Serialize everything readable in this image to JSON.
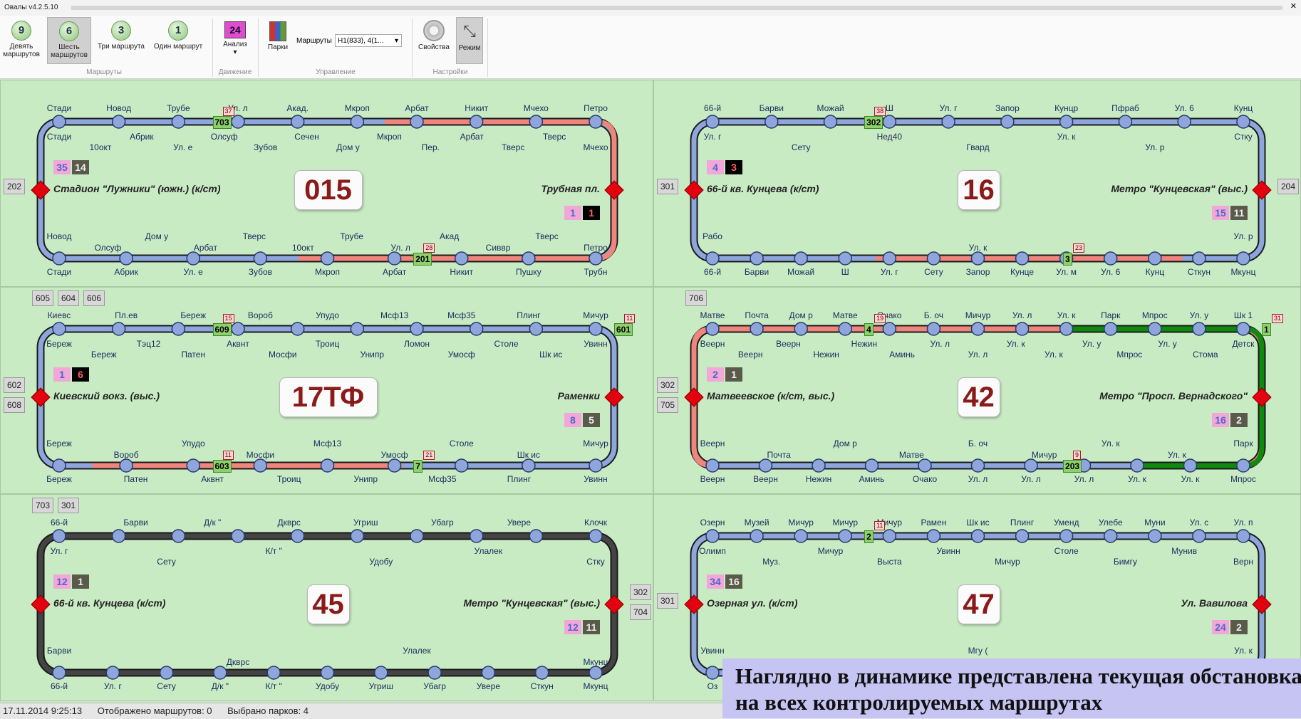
{
  "window": {
    "title": "Овалы v4.2.5.10"
  },
  "ribbon": {
    "buttons": [
      {
        "num": "9",
        "label": "Девять маршрутов"
      },
      {
        "num": "6",
        "label": "Шесть маршрутов"
      },
      {
        "num": "3",
        "label": "Три маршрута"
      },
      {
        "num": "1",
        "label": "Один маршрут"
      }
    ],
    "groups": {
      "routes": "Маршруты",
      "movement": "Движение",
      "control": "Управление",
      "settings": "Настройки"
    },
    "analysis": {
      "num": "24",
      "label": "Анализ"
    },
    "parks_label": "Парки",
    "routes_combo_label": "Маршруты",
    "routes_combo_value": "Н1(833), 4(1...",
    "props_label": "Свойства",
    "mode_label": "Режим"
  },
  "status": {
    "datetime": "17.11.2014 9:25:13",
    "shown": "Отображено маршрутов: 0",
    "parks": "Выбрано парков: 4"
  },
  "overlay": {
    "text": "Наглядно в динамике представлена текущая обстановка на всех контролируемых маршрутах"
  },
  "panels": [
    {
      "route": "015",
      "left_terminal": "Стадион \"Лужники\" (южн.) (к/ст)",
      "right_terminal": "Трубная пл.",
      "left_garages": [
        "202"
      ],
      "right_garages": [],
      "top_garages": [],
      "left_counts": [
        "35",
        "14"
      ],
      "right_counts": [
        "1",
        "1"
      ],
      "right_black": true,
      "left_black": false,
      "top_labels": [
        "Стади",
        "Новод",
        "Трубе",
        "Ул. л",
        "Акад.",
        "Мкроп",
        "Арбат",
        "Никит",
        "Мчехо",
        "Петро"
      ],
      "top_labels2": [
        "Стади",
        "10окт",
        "Абрик",
        "Ул. е",
        "Олсуф",
        "Зубов",
        "Сечен",
        "Дом у",
        "Мкроп",
        "Пер.",
        "Арбат",
        "Тверс",
        "Тверс",
        "Мчехо"
      ],
      "bottom_labels": [
        "Новод",
        "Олсуф",
        "Дом у",
        "Арбат",
        "Тверс",
        "10окт",
        "Трубе",
        "Ул. л",
        "Акад",
        "Сиввр",
        "Тверс",
        "Петро"
      ],
      "bottom_labels2": [
        "Стади",
        "Абрик",
        "Ул. е",
        "Зубов",
        "Мкроп",
        "Арбат",
        "Никит",
        "Пушку",
        "Трубн"
      ],
      "buses": [
        {
          "id": "703",
          "badge": "37"
        },
        {
          "id": "201",
          "badge": "28"
        }
      ]
    },
    {
      "route": "16",
      "left_terminal": "66-й кв. Кунцева (к/ст)",
      "right_terminal": "Метро \"Кунцевская\" (выс.)",
      "left_garages": [
        "301"
      ],
      "right_garages": [
        "204"
      ],
      "top_garages": [],
      "left_counts": [
        "4",
        "3"
      ],
      "right_counts": [
        "15",
        "11"
      ],
      "right_black": false,
      "left_black": true,
      "top_labels": [
        "66-й",
        "Барви",
        "Можай",
        "Ш",
        "Ул. г",
        "Запор",
        "Кунцр",
        "Пфраб",
        "Ул. 6",
        "Кунц"
      ],
      "top_labels2": [
        "Ул. г",
        "Сету",
        "Нед40",
        "Гвард",
        "Ул. к",
        "Ул. р",
        "Стку"
      ],
      "bottom_labels": [
        "Рабо",
        "Ул. к",
        "Ул. р"
      ],
      "bottom_labels2": [
        "66-й",
        "Барви",
        "Можай",
        "Ш",
        "Ул. г",
        "Сету",
        "Запор",
        "Кунце",
        "Ул. м",
        "Ул. 6",
        "Кунц",
        "Сткун",
        "Мкунц"
      ],
      "buses": [
        {
          "id": "302",
          "badge": "38"
        },
        {
          "id": "3",
          "badge": "23"
        }
      ]
    },
    {
      "route": "17ТФ",
      "left_terminal": "Киевский вокз. (выс.)",
      "right_terminal": "Раменки",
      "left_garages": [
        "602",
        "608"
      ],
      "right_garages": [],
      "top_garages": [
        "605",
        "604",
        "606"
      ],
      "left_counts": [
        "1",
        "6"
      ],
      "right_counts": [
        "8",
        "5"
      ],
      "right_black": false,
      "left_black": true,
      "top_labels": [
        "Киевс",
        "Пл.ев",
        "Береж",
        "Вороб",
        "Упудо",
        "Мсф13",
        "Мсф35",
        "Плинг",
        "Мичур"
      ],
      "top_labels2": [
        "Береж",
        "Береж",
        "Тэц12",
        "Патен",
        "Аквнт",
        "Мосфи",
        "Троиц",
        "Унипр",
        "Ломон",
        "Умосф",
        "Столе",
        "Шк ис",
        "Увинн"
      ],
      "bottom_labels": [
        "Береж",
        "Вороб",
        "Упудо",
        "Мосфи",
        "Мсф13",
        "Умосф",
        "Столе",
        "Шк ис",
        "Мичур"
      ],
      "bottom_labels2": [
        "Береж",
        "Патен",
        "Аквнт",
        "Троиц",
        "Унипр",
        "Мсф35",
        "Плинг",
        "Увинн"
      ],
      "buses": [
        {
          "id": "609",
          "badge": "15"
        },
        {
          "id": "7",
          "badge": "21"
        },
        {
          "id": "601",
          "badge": "11"
        },
        {
          "id": "603",
          "badge": "11"
        }
      ]
    },
    {
      "route": "42",
      "left_terminal": "Матвеевское (к/ст, выс.)",
      "right_terminal": "Метро \"Просп. Вернадского\"",
      "left_garages": [
        "302",
        "705"
      ],
      "right_garages": [],
      "top_garages": [
        "706"
      ],
      "left_counts": [
        "2",
        "1"
      ],
      "right_counts": [
        "16",
        "2"
      ],
      "right_black": false,
      "left_black": false,
      "top_labels": [
        "Матве",
        "Почта",
        "Дом р",
        "Матве",
        "Очако",
        "Б. оч",
        "Мичур",
        "Ул. л",
        "Ул. к",
        "Парк",
        "Мпрос",
        "Ул. у",
        "Шк 1"
      ],
      "top_labels2": [
        "Веерн",
        "Веерн",
        "Веерн",
        "Нежин",
        "Нежин",
        "Аминь",
        "Ул. л",
        "Ул. л",
        "Ул. к",
        "Ул. к",
        "Ул. у",
        "Мпрос",
        "Ул. у",
        "Стома",
        "Детск"
      ],
      "bottom_labels": [
        "Веерн",
        "Почта",
        "Дом р",
        "Матве",
        "Б. оч",
        "Мичур",
        "Ул. к",
        "Ул. к",
        "Парк"
      ],
      "bottom_labels2": [
        "Веерн",
        "Веерн",
        "Нежин",
        "Аминь",
        "Очако",
        "Ул. л",
        "Ул. л",
        "Ул. л",
        "Ул. к",
        "Ул. к",
        "Мпрос"
      ],
      "buses": [
        {
          "id": "4",
          "badge": "19"
        },
        {
          "id": "203",
          "badge": "9"
        },
        {
          "id": "1",
          "badge": "31"
        }
      ]
    },
    {
      "route": "45",
      "left_terminal": "66-й кв. Кунцева (к/ст)",
      "right_terminal": "Метро \"Кунцевская\" (выс.)",
      "left_garages": [],
      "right_garages": [
        "302",
        "704"
      ],
      "top_garages": [
        "703",
        "301"
      ],
      "left_counts": [
        "12",
        "1"
      ],
      "right_counts": [
        "12",
        "11"
      ],
      "right_black": false,
      "left_black": false,
      "top_labels": [
        "66-й",
        "Барви",
        "Д/к \"",
        "Дкврс",
        "Угриш",
        "Убагр",
        "Увере",
        "Клочк"
      ],
      "top_labels2": [
        "Ул. г",
        "Сету",
        "К/т \"",
        "Удобу",
        "Улалек",
        "Стку"
      ],
      "bottom_labels": [
        "Барви",
        "Дкврс",
        "Улалек",
        "Мкунц"
      ],
      "bottom_labels2": [
        "66-й",
        "Ул. г",
        "Сету",
        "Д/к \"",
        "К/т \"",
        "Удобу",
        "Угриш",
        "Убагр",
        "Увере",
        "Сткун",
        "Мкунц"
      ],
      "buses": []
    },
    {
      "route": "47",
      "left_terminal": "Озерная ул. (к/ст)",
      "right_terminal": "Ул. Вавилова",
      "left_garages": [
        "301"
      ],
      "right_garages": [],
      "top_garages": [],
      "left_counts": [
        "34",
        "16"
      ],
      "right_counts": [
        "24",
        "2"
      ],
      "right_black": false,
      "left_black": false,
      "top_labels": [
        "Озерн",
        "Музей",
        "Мичур",
        "Мичур",
        "Мичур",
        "Рамен",
        "Шк ис",
        "Плинг",
        "Уменд",
        "Улебе",
        "Муни",
        "Ул. с",
        "Ул. п"
      ],
      "top_labels2": [
        "Олимп",
        "Муз.",
        "Мичур",
        "Выста",
        "Увинн",
        "Мичур",
        "Столе",
        "Бимгу",
        "Мунив",
        "Верн"
      ],
      "bottom_labels": [
        "Увинн",
        "Шк ис",
        "Мгу (",
        "Мгу (",
        "Ул. к"
      ],
      "bottom_labels2": [
        "Оз"
      ],
      "buses": [
        {
          "id": "2",
          "badge": "11"
        }
      ]
    }
  ]
}
